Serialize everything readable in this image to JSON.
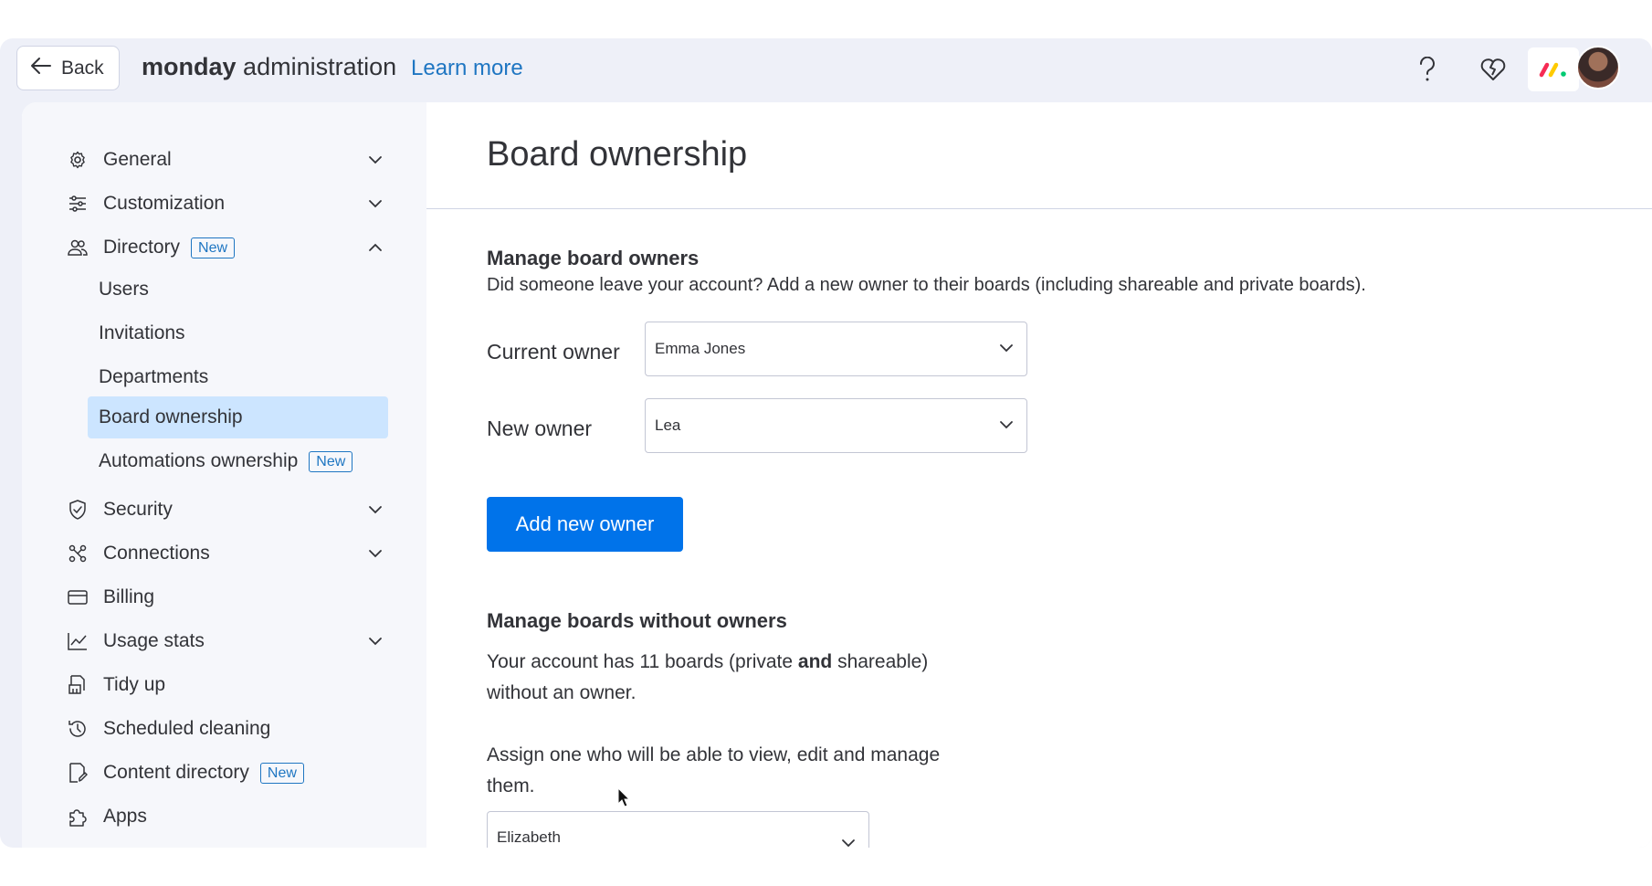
{
  "topbar": {
    "back_label": "Back",
    "brand_bold": "monday",
    "brand_rest": "administration",
    "learn_more": "Learn more",
    "icons": [
      "help-icon",
      "heart-icon",
      "monday-logo-icon",
      "avatar"
    ]
  },
  "sidebar": {
    "items": [
      {
        "label": "General",
        "icon": "gear-icon",
        "expandable": true
      },
      {
        "label": "Customization",
        "icon": "sliders-icon",
        "expandable": true
      },
      {
        "label": "Directory",
        "icon": "users-icon",
        "badge": "New",
        "expanded": true
      },
      {
        "label": "Security",
        "icon": "shield-icon",
        "expandable": true
      },
      {
        "label": "Connections",
        "icon": "connections-icon",
        "expandable": true
      },
      {
        "label": "Billing",
        "icon": "card-icon"
      },
      {
        "label": "Usage stats",
        "icon": "chart-icon",
        "expandable": true
      },
      {
        "label": "Tidy up",
        "icon": "broom-icon"
      },
      {
        "label": "Scheduled cleaning",
        "icon": "clock-icon"
      },
      {
        "label": "Content directory",
        "icon": "document-icon",
        "badge": "New"
      },
      {
        "label": "Apps",
        "icon": "puzzle-icon"
      }
    ],
    "directory_sub": [
      {
        "label": "Users"
      },
      {
        "label": "Invitations"
      },
      {
        "label": "Departments"
      },
      {
        "label": "Board ownership",
        "active": true
      },
      {
        "label": "Automations ownership",
        "badge": "New"
      }
    ]
  },
  "main": {
    "title": "Board ownership",
    "manage_owners": {
      "heading": "Manage board owners",
      "description": "Did someone leave your account? Add a new owner to their boards (including shareable and private boards).",
      "current_owner_label": "Current owner",
      "current_owner_value": "Emma Jones",
      "new_owner_label": "New owner",
      "new_owner_value": "Lea",
      "add_button": "Add new owner"
    },
    "without_owners": {
      "heading": "Manage boards without owners",
      "text1_a": "Your account has 11 boards (private ",
      "text1_bold": "and",
      "text1_b": " shareable)",
      "text1_c": "without an owner.",
      "text2_a": "Assign one who will be able to view, edit and manage",
      "text2_b": "them.",
      "assign_value": "Elizabeth"
    }
  },
  "colors": {
    "primary": "#0073ea",
    "link": "#1f76c2",
    "active_bg": "#cce5ff",
    "frame_bg": "#eef0f8",
    "sidebar_bg": "#f6f7fb"
  }
}
